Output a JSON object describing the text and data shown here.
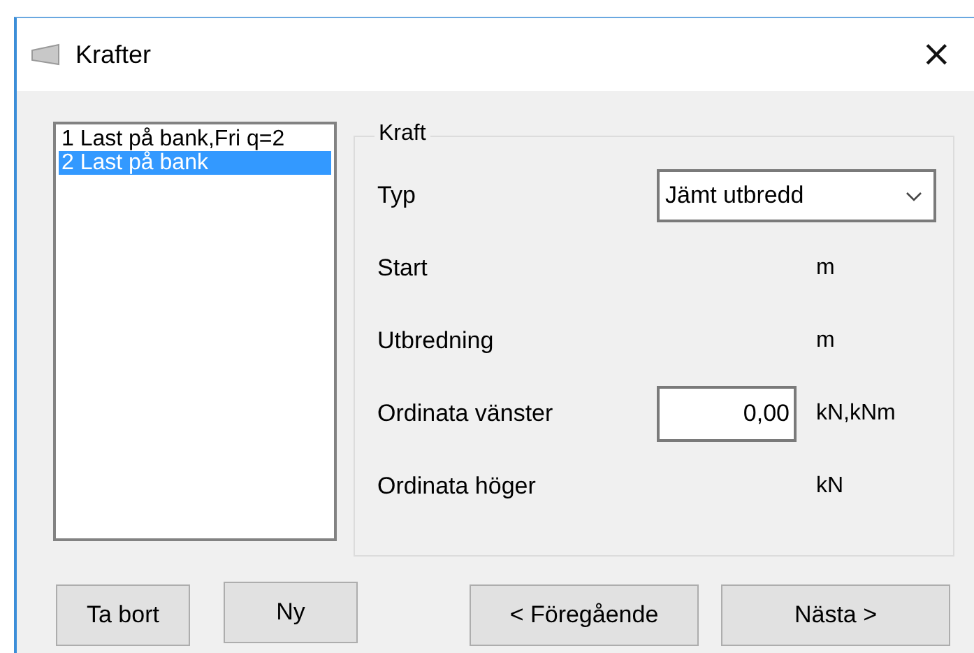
{
  "window": {
    "title": "Krafter",
    "close": "×"
  },
  "list": {
    "items": [
      {
        "label": "1 Last på bank,Fri q=2",
        "selected": false
      },
      {
        "label": "2 Last på bank",
        "selected": true
      }
    ]
  },
  "group": {
    "title": "Kraft",
    "rows": [
      {
        "kind": "combo",
        "label": "Typ",
        "value": "Jämt utbredd"
      },
      {
        "kind": "plain",
        "label": "Start",
        "unit": "m"
      },
      {
        "kind": "plain",
        "label": "Utbredning",
        "unit": "m"
      },
      {
        "kind": "input",
        "label": "Ordinata vänster",
        "value": "0,00",
        "unit": "kN,kNm"
      },
      {
        "kind": "plain",
        "label": "Ordinata höger",
        "unit": "kN"
      }
    ]
  },
  "buttons": [
    {
      "label": "Ta bort"
    },
    {
      "label": "Ny"
    },
    {
      "label": "< Föregående"
    },
    {
      "label": "Nästa >"
    }
  ]
}
